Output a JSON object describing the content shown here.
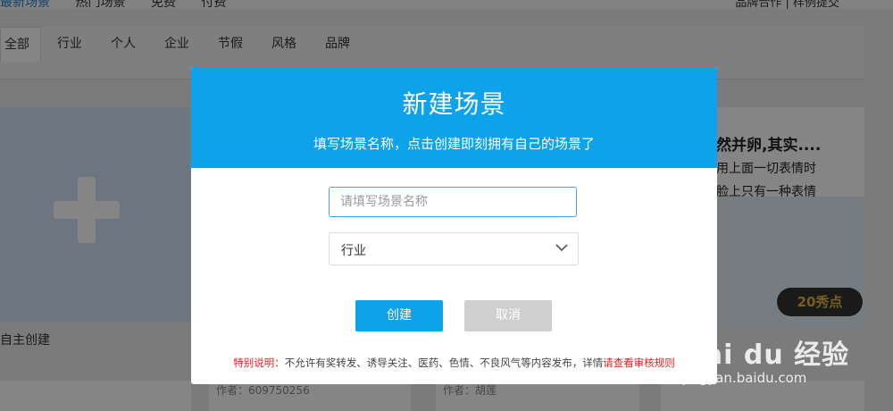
{
  "topnav": {
    "items": [
      "最新场景",
      "热门场景",
      "免费",
      "付费"
    ],
    "right": "品牌合作 | 样例提交"
  },
  "categories": [
    "全部",
    "行业",
    "个人",
    "企业",
    "节假",
    "风格",
    "品牌"
  ],
  "cards": {
    "new_label": "自主创建",
    "right_title": "然并卵,其实....",
    "right_line1": "用上面一切表情时",
    "right_line2": "脸上只有一种表情",
    "price": "20秀点",
    "bottom_left": "作者：609750256",
    "bottom_mid": "作者：胡莲"
  },
  "watermark": {
    "brand": "Bai du 经验",
    "url": "jingyan.baidu.com"
  },
  "modal": {
    "title": "新建场景",
    "subtitle": "填写场景名称，点击创建即刻拥有自己的场景了",
    "name_placeholder": "请填写场景名称",
    "name_value": "",
    "category_selected": "行业",
    "create_label": "创建",
    "cancel_label": "取消",
    "notice_prefix": "特别说明：",
    "notice_body": "不允许有奖转发、诱导关注、医药、色情、不良风气等内容发布，详情",
    "notice_link": "请查看审核规则"
  },
  "colors": {
    "accent": "#0ea2ea",
    "notice_red": "#e02020",
    "price_gold": "#e4b23c"
  }
}
